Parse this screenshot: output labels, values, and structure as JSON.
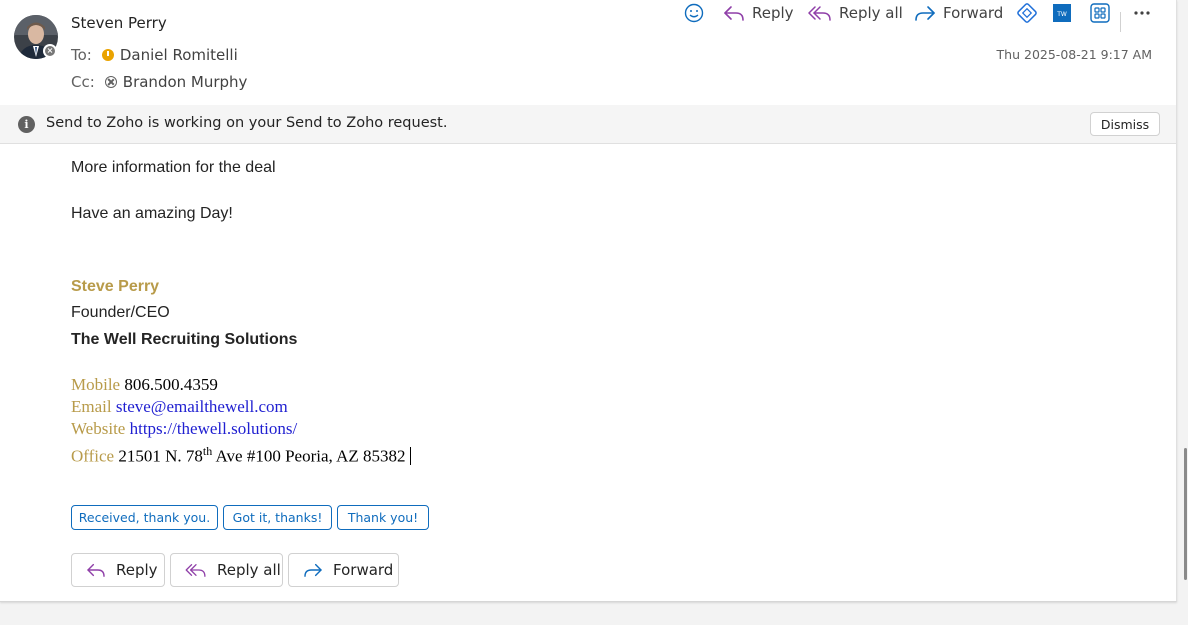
{
  "sender": {
    "name": "Steven Perry",
    "avatar_icon": "person-photo"
  },
  "to": {
    "label": "To:",
    "name": "Daniel Romitelli",
    "status": "away"
  },
  "cc": {
    "label": "Cc:",
    "name": "Brandon Murphy",
    "status": "offline"
  },
  "date": "Thu 2025-08-21 9:17 AM",
  "toolbar": {
    "reply": "Reply",
    "reply_all": "Reply all",
    "forward": "Forward"
  },
  "infobar": {
    "message": "Send to Zoho is working on your Send to Zoho request.",
    "dismiss": "Dismiss"
  },
  "body": {
    "line1": "More information for the deal",
    "line2": "Have an amazing Day!"
  },
  "signature": {
    "name": "Steve Perry",
    "title": "Founder/CEO",
    "company": "The Well Recruiting Solutions",
    "mobile_label": "Mobile",
    "mobile": "806.500.4359",
    "email_label": "Email",
    "email": "steve@emailthewell.com",
    "website_label": "Website",
    "website": "https://thewell.solutions/",
    "office_label": "Office",
    "office_pre": "21501 N. 78",
    "office_sup": "th",
    "office_post": "Ave #100 Peoria, AZ 85382"
  },
  "suggested_replies": [
    "Received, thank you.",
    "Got it, thanks!",
    "Thank you!"
  ],
  "actions": {
    "reply": "Reply",
    "reply_all": "Reply all",
    "forward": "Forward"
  },
  "colors": {
    "accent": "#0f6cbd",
    "reply_purple": "#8f3fa8",
    "forward_blue": "#0f6cbd",
    "signature_gold": "#b89b4a"
  }
}
